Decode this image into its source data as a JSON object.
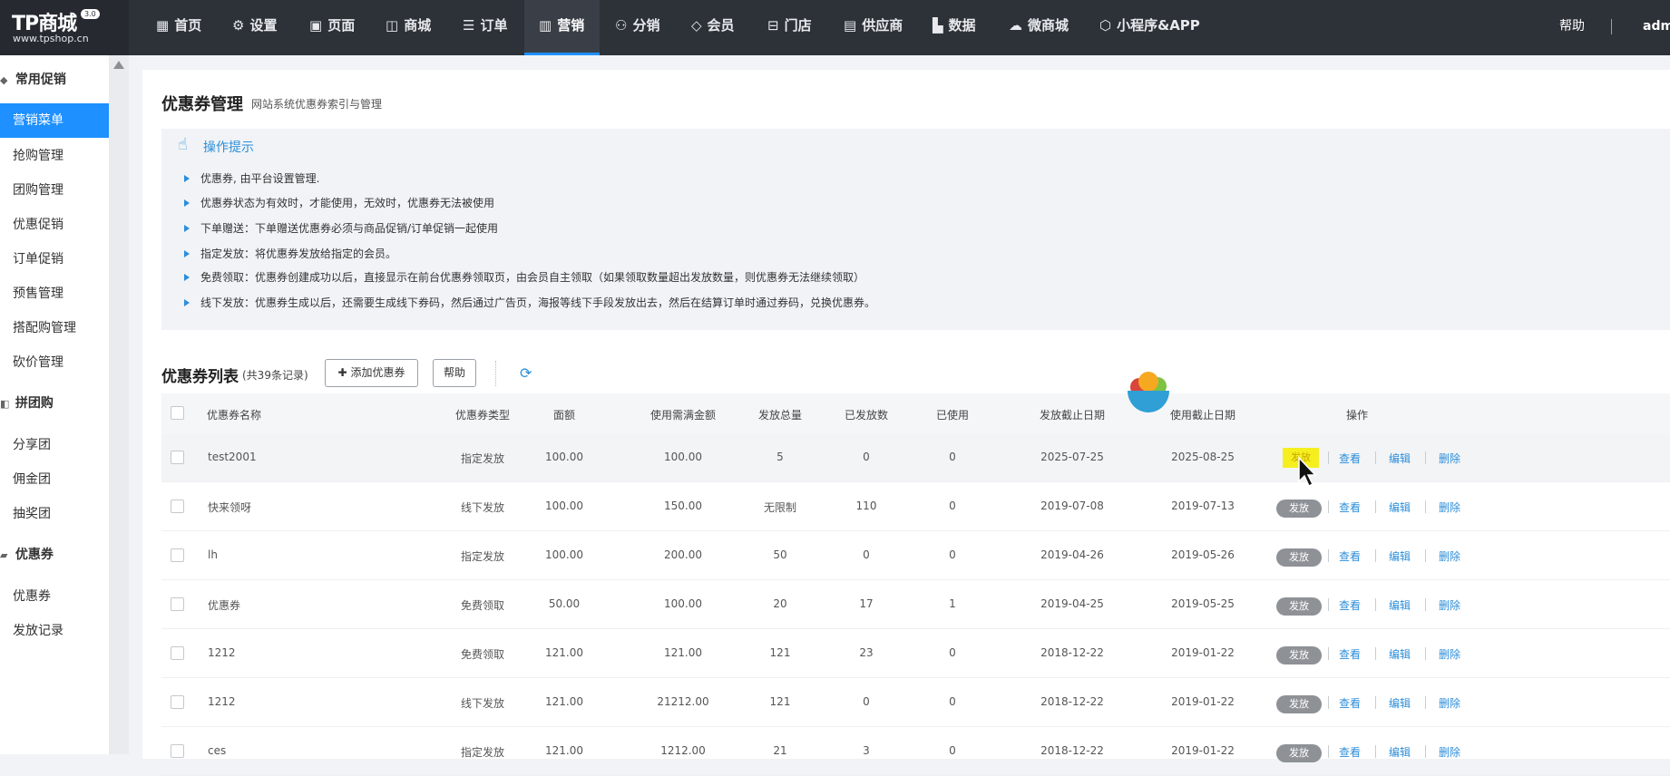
{
  "brand": {
    "name": "TP商城",
    "version": "3.0",
    "url": "www.tpshop.cn"
  },
  "topnav": [
    {
      "label": "首页",
      "icon": "dashboard-icon"
    },
    {
      "label": "设置",
      "icon": "gear-icon"
    },
    {
      "label": "页面",
      "icon": "page-icon"
    },
    {
      "label": "商城",
      "icon": "shopping-bag-icon"
    },
    {
      "label": "订单",
      "icon": "order-icon"
    },
    {
      "label": "营销",
      "icon": "marketing-icon",
      "active": true
    },
    {
      "label": "分销",
      "icon": "users-icon"
    },
    {
      "label": "会员",
      "icon": "diamond-icon"
    },
    {
      "label": "门店",
      "icon": "store-icon"
    },
    {
      "label": "供应商",
      "icon": "supplier-icon"
    },
    {
      "label": "数据",
      "icon": "bar-chart-icon"
    },
    {
      "label": "微商城",
      "icon": "wechat-icon"
    },
    {
      "label": "小程序&APP",
      "icon": "cube-icon"
    }
  ],
  "header_right": {
    "help": "帮助",
    "user": "adm"
  },
  "sidebar": {
    "groups": [
      {
        "label": "常用促销",
        "items": [
          "营销菜单",
          "抢购管理",
          "团购管理",
          "优惠促销",
          "订单促销",
          "预售管理",
          "搭配购管理",
          "砍价管理"
        ],
        "active": "营销菜单"
      },
      {
        "label": "拼团购",
        "items": [
          "分享团",
          "佣金团",
          "抽奖团"
        ]
      },
      {
        "label": "优惠券",
        "items": [
          "优惠券",
          "发放记录"
        ]
      }
    ]
  },
  "page": {
    "title": "优惠券管理",
    "subtitle": "网站系统优惠券索引与管理"
  },
  "tips": {
    "title": "操作提示",
    "items": [
      "优惠券, 由平台设置管理.",
      "优惠券状态为有效时，才能使用，无效时，优惠券无法被使用",
      "下单赠送：下单赠送优惠券必须与商品促销/订单促销一起使用",
      "指定发放：将优惠券发放给指定的会员。",
      "免费领取：优惠券创建成功以后，直接显示在前台优惠券领取页，由会员自主领取（如果领取数量超出发放数量，则优惠券无法继续领取）",
      "线下发放：优惠券生成以后，还需要生成线下券码，然后通过广告页，海报等线下手段发放出去，然后在结算订单时通过券码，兑换优惠券。"
    ]
  },
  "list": {
    "title": "优惠券列表",
    "count_text": "(共39条记录)",
    "add_button": "添加优惠券",
    "help_button": "帮助"
  },
  "table": {
    "columns": [
      "优惠券名称",
      "优惠券类型",
      "面额",
      "使用需满金额",
      "发放总量",
      "已发放数",
      "已使用",
      "发放截止日期",
      "使用截止日期",
      "操作"
    ],
    "rows": [
      {
        "name": "test2001",
        "type": "指定发放",
        "amount": "100.00",
        "min": "100.00",
        "total": "5",
        "issued": "0",
        "used": "0",
        "issue_end": "2025-07-25",
        "use_end": "2025-08-25"
      },
      {
        "name": "快来领呀",
        "type": "线下发放",
        "amount": "100.00",
        "min": "150.00",
        "total": "无限制",
        "issued": "110",
        "used": "0",
        "issue_end": "2019-07-08",
        "use_end": "2019-07-13"
      },
      {
        "name": "lh",
        "type": "指定发放",
        "amount": "100.00",
        "min": "200.00",
        "total": "50",
        "issued": "0",
        "used": "0",
        "issue_end": "2019-04-26",
        "use_end": "2019-05-26"
      },
      {
        "name": "优惠券",
        "type": "免费领取",
        "amount": "50.00",
        "min": "100.00",
        "total": "20",
        "issued": "17",
        "used": "1",
        "issue_end": "2019-04-25",
        "use_end": "2019-05-25"
      },
      {
        "name": "1212",
        "type": "免费领取",
        "amount": "121.00",
        "min": "121.00",
        "total": "121",
        "issued": "23",
        "used": "0",
        "issue_end": "2018-12-22",
        "use_end": "2019-01-22"
      },
      {
        "name": "1212",
        "type": "线下发放",
        "amount": "121.00",
        "min": "21212.00",
        "total": "121",
        "issued": "0",
        "used": "0",
        "issue_end": "2018-12-22",
        "use_end": "2019-01-22"
      },
      {
        "name": "ces",
        "type": "指定发放",
        "amount": "121.00",
        "min": "1212.00",
        "total": "21",
        "issued": "3",
        "used": "0",
        "issue_end": "2018-12-22",
        "use_end": "2019-01-22"
      }
    ],
    "actions": {
      "issue": "发放",
      "view": "查看",
      "edit": "编辑",
      "delete": "删除"
    }
  },
  "colors": {
    "accent": "#1e90ff",
    "topbar": "#2d3138",
    "link": "#2c8ed9",
    "highlight": "#f6ef1f"
  }
}
